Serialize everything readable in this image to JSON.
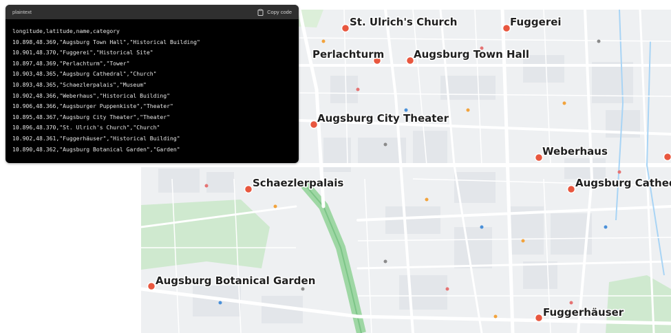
{
  "code_panel": {
    "language": "plaintext",
    "copy_label": "Copy code",
    "copy_icon": "clipboard-icon",
    "lines": [
      "longitude,latitude,name,category",
      "10.898,48.369,\"Augsburg Town Hall\",\"Historical Building\"",
      "10.901,48.370,\"Fuggerei\",\"Historical Site\"",
      "10.897,48.369,\"Perlachturm\",\"Tower\"",
      "10.903,48.365,\"Augsburg Cathedral\",\"Church\"",
      "10.893,48.365,\"Schaezlerpalais\",\"Museum\"",
      "10.902,48.366,\"Weberhaus\",\"Historical Building\"",
      "10.906,48.366,\"Augsburger Puppenkiste\",\"Theater\"",
      "10.895,48.367,\"Augsburg City Theater\",\"Theater\"",
      "10.896,48.370,\"St. Ulrich's Church\",\"Church\"",
      "10.902,48.361,\"Fuggerhäuser\",\"Historical Building\"",
      "10.890,48.362,\"Augsburg Botanical Garden\",\"Garden\""
    ]
  },
  "map": {
    "marker_color": "#e8573f",
    "park_color": "#cfe9cf",
    "rail_color": "#9ed7a4",
    "road_color": "#ffffff",
    "background_color": "#eef0f2",
    "markers": [
      {
        "name": "St. Ulrich's Church"
      },
      {
        "name": "Fuggerei"
      },
      {
        "name": "Perlachturm"
      },
      {
        "name": "Augsburg Town Hall"
      },
      {
        "name": "Augsburg City Theater"
      },
      {
        "name": "Weberhaus"
      },
      {
        "name": "Schaezlerpalais"
      },
      {
        "name": "Augsburg Cathedral"
      },
      {
        "name": "Augsburg Botanical Garden"
      },
      {
        "name": "Fuggerhäuser"
      },
      {
        "name": ""
      }
    ]
  }
}
